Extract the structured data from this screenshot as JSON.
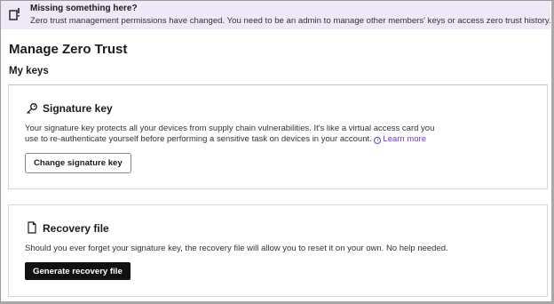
{
  "banner": {
    "title": "Missing something here?",
    "text": "Zero trust management permissions have changed. You need to be an admin to manage other members' keys or access zero trust history.",
    "icon": "info-exclamation-icon",
    "background": "#efe8f8"
  },
  "page": {
    "title": "Manage Zero Trust",
    "section_title": "My keys"
  },
  "signature_card": {
    "icon": "key-icon",
    "title": "Signature key",
    "description_line1": "Your signature key protects all your devices from supply chain vulnerabilities. It's like a virtual access card you",
    "description_line2": "use to re-authenticate yourself before performing a sensitive task on devices in your account.",
    "learn_more": "Learn more",
    "button_label": "Change signature key"
  },
  "recovery_card": {
    "icon": "document-icon",
    "title": "Recovery file",
    "description": "Should you ever forget your signature key, the recovery file will allow you to reset it on your own. No help needed.",
    "button_label": "Generate recovery file"
  },
  "colors": {
    "link": "#6b3fb8",
    "primary_button": "#111111"
  }
}
